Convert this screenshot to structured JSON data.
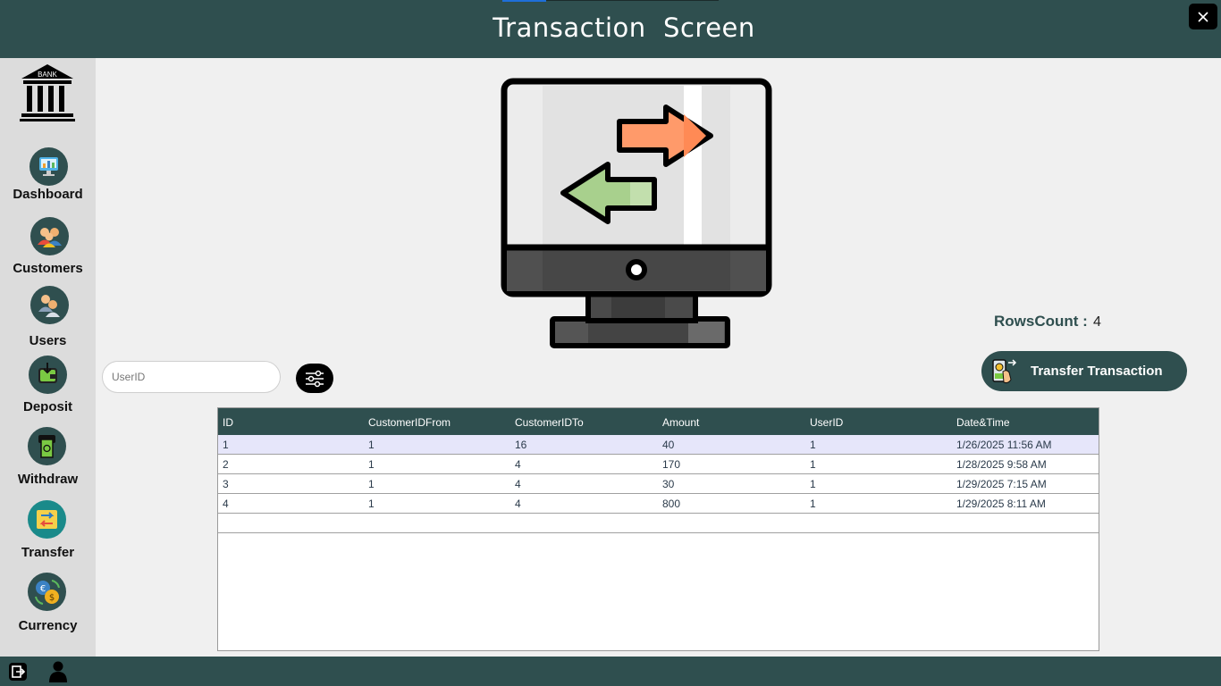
{
  "window": {
    "title": "Transaction  Screen",
    "close_icon": "close-icon"
  },
  "sidebar": {
    "logo_text": "BANK",
    "items": [
      {
        "label": "Dashboard",
        "icon": "dashboard-icon"
      },
      {
        "label": "Customers",
        "icon": "customers-icon"
      },
      {
        "label": "Users",
        "icon": "users-icon"
      },
      {
        "label": "Deposit",
        "icon": "deposit-icon"
      },
      {
        "label": "Withdraw",
        "icon": "withdraw-icon"
      },
      {
        "label": "Transfer",
        "icon": "transfer-icon"
      },
      {
        "label": "Currency",
        "icon": "currency-icon"
      }
    ]
  },
  "rows_count": {
    "label": "RowsCount :",
    "value": "4"
  },
  "transfer_button": {
    "label": "Transfer Transaction",
    "icon": "transfer-money-icon"
  },
  "search": {
    "placeholder": "UserID",
    "value": ""
  },
  "filter_button": {
    "icon": "filter-sliders-icon"
  },
  "table": {
    "columns": [
      "ID",
      "CustomerIDFrom",
      "CustomerIDTo",
      "Amount",
      "UserID",
      "Date&Time"
    ],
    "rows": [
      [
        "1",
        "1",
        "16",
        "40",
        "1",
        "1/26/2025 11:56 AM"
      ],
      [
        "2",
        "1",
        "4",
        "170",
        "1",
        "1/28/2025 9:58 AM"
      ],
      [
        "3",
        "1",
        "4",
        "30",
        "1",
        "1/29/2025 7:15 AM"
      ],
      [
        "4",
        "1",
        "4",
        "800",
        "1",
        "1/29/2025 8:11 AM"
      ]
    ],
    "selected_row": 0
  },
  "footer": {
    "icons": [
      "logout-icon",
      "user-icon"
    ]
  },
  "colors": {
    "primary": "#2f4f4f",
    "selected_row": "#e6e6fa",
    "background": "#f0f0f0",
    "sidebar": "#dcdcdc"
  }
}
